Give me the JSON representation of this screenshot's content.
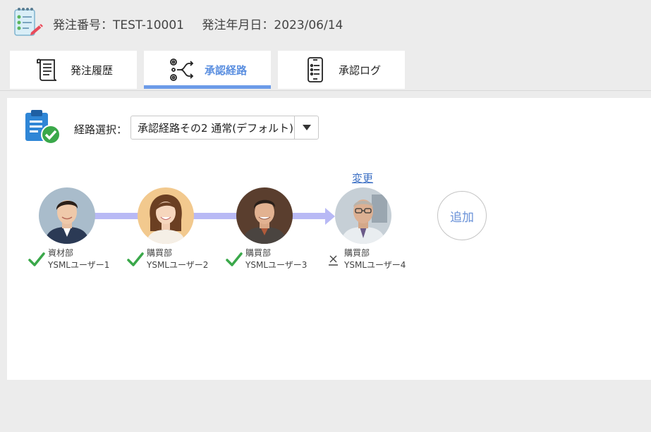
{
  "header": {
    "order_number": "発注番号：TEST-10001",
    "order_date": "発注年月日：2023/06/14",
    "icon": "checklist-icon"
  },
  "tabs": [
    {
      "label": "発注履歴",
      "icon": "scroll-icon",
      "active": false
    },
    {
      "label": "承認経路",
      "icon": "route-icon",
      "active": true
    },
    {
      "label": "承認ログ",
      "icon": "phone-list-icon",
      "active": false
    }
  ],
  "route": {
    "label": "経路選択：",
    "selected": "承認経路その2 通常(デフォルト)",
    "icon": "clipboard-check-icon"
  },
  "change_link": "変更",
  "approvers": [
    {
      "dept": "資材部",
      "name": "YSMLユーザー1",
      "status": "approved"
    },
    {
      "dept": "購買部",
      "name": "YSMLユーザー2",
      "status": "approved"
    },
    {
      "dept": "購買部",
      "name": "YSMLユーザー3",
      "status": "approved"
    },
    {
      "dept": "購買部",
      "name": "YSMLユーザー4",
      "status": "pending"
    }
  ],
  "add_button": "追加",
  "colors": {
    "accent": "#6c9be8",
    "connector": "#b8b9f5",
    "check": "#3aa84a"
  }
}
